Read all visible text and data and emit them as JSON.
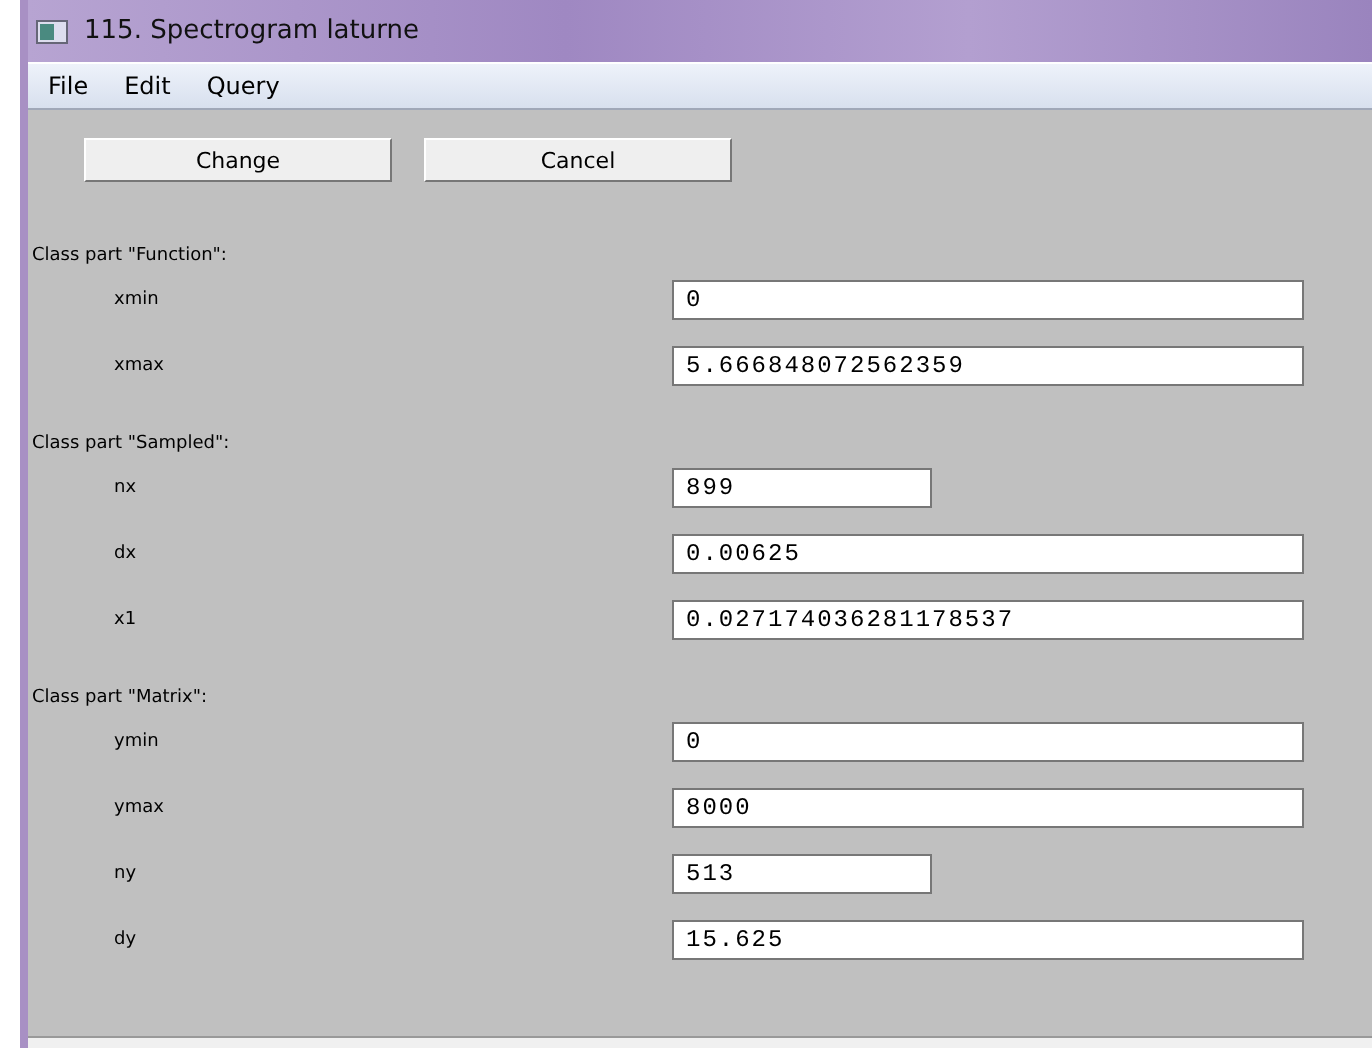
{
  "window": {
    "title": "115. Spectrogram laturne"
  },
  "menu": [
    "File",
    "Edit",
    "Query"
  ],
  "buttons": [
    "Change",
    "Cancel"
  ],
  "sections": [
    {
      "title": "Class part \"Function\":",
      "fields": [
        {
          "label": "xmin",
          "value": "0",
          "kind": "long"
        },
        {
          "label": "xmax",
          "value": "5.666848072562359",
          "kind": "long"
        }
      ]
    },
    {
      "title": "Class part \"Sampled\":",
      "fields": [
        {
          "label": "nx",
          "value": "899",
          "kind": "short"
        },
        {
          "label": "dx",
          "value": "0.00625",
          "kind": "long"
        },
        {
          "label": "x1",
          "value": "0.027174036281178537",
          "kind": "long"
        }
      ]
    },
    {
      "title": "Class part \"Matrix\":",
      "fields": [
        {
          "label": "ymin",
          "value": "0",
          "kind": "long"
        },
        {
          "label": "ymax",
          "value": "8000",
          "kind": "long"
        },
        {
          "label": "ny",
          "value": "513",
          "kind": "short"
        },
        {
          "label": "dy",
          "value": "15.625",
          "kind": "long"
        }
      ]
    }
  ]
}
